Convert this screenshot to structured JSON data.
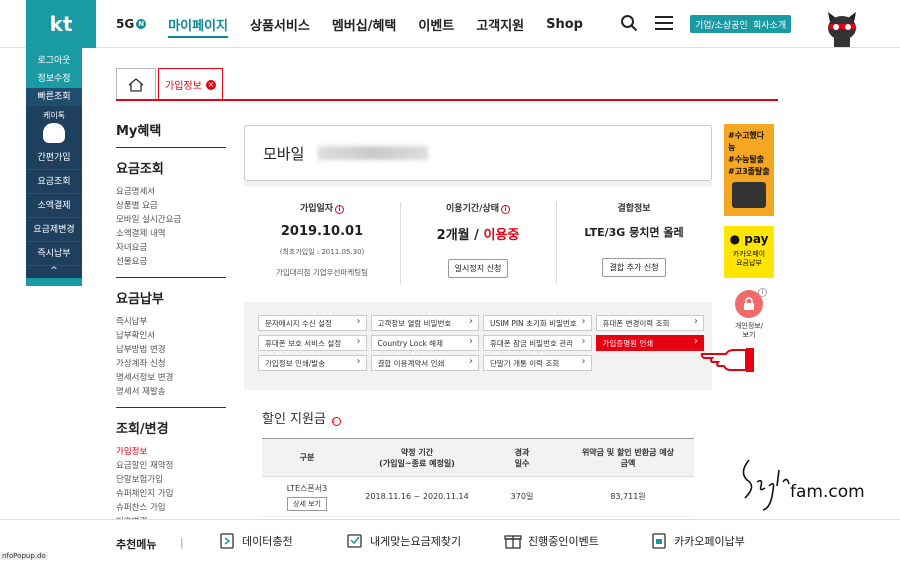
{
  "header": {
    "logo": "kt",
    "nav": [
      {
        "label": "5G",
        "badge": "N"
      },
      {
        "label": "마이페이지"
      },
      {
        "label": "상품서비스"
      },
      {
        "label": "멤버십/혜택"
      },
      {
        "label": "이벤트"
      },
      {
        "label": "고객지원"
      },
      {
        "label": "Shop"
      }
    ],
    "btn_business": "기업/소상공인",
    "btn_company": "회사소개"
  },
  "quick_menu": {
    "items_top": [
      "로그아웃",
      "정보수정",
      "빠른조회"
    ],
    "character_label": "케이톡",
    "items": [
      "간편가입",
      "요금조회",
      "소액결제",
      "요금제변경",
      "즉시납부"
    ],
    "arrow": "^"
  },
  "tabs": {
    "active_label": "가입정보",
    "close": "×"
  },
  "sidemenu": {
    "h_benefit": "My혜택",
    "h_bill": "요금조회",
    "bill_links": [
      "요금명세서",
      "상품별 요금",
      "모바일 실시간요금",
      "소액결제 내역",
      "자녀요금",
      "선물요금"
    ],
    "h_pay": "요금납부",
    "pay_links": [
      "즉시납부",
      "납부확인서",
      "납부방법 변경",
      "가상계좌 신청",
      "명세서정보 변경",
      "명세서 재발송"
    ],
    "h_change": "조회/변경",
    "change_links": [
      "가입정보",
      "요금할인 재약정",
      "단말보험가입",
      "슈퍼체인지 가입",
      "슈퍼찬스 가입",
      "번호변경"
    ]
  },
  "main": {
    "mobile_label": "모바일",
    "join_date_h": "가입일자",
    "join_date": "2019.10.01",
    "first_join": "(최초가입일 : 2011.05.30)",
    "agency": "가입대리점 기업우선마케팅팀",
    "period_h": "이용기간/상태",
    "period": "2개월 /",
    "status": "이용중",
    "suspend_btn": "일시정지 신청",
    "bundle_h": "결합정보",
    "bundle": "LTE/3G 뭉치면 올레",
    "bundle_btn": "결합 추가 신청",
    "actions": [
      "문자메시지 수신 설정",
      "고객정보 열람 비밀번호",
      "USIM PIN 초기화 비밀번호",
      "휴대폰 변경이력 조회",
      "휴대폰 보호 서비스 설정",
      "Country Lock 해제",
      "휴대폰 잠금 비밀번호 관리",
      "가입증명원 인쇄",
      "가입정보 인쇄/발송",
      "결합 이용계약서 인쇄",
      "단말기 개통 이력 조회"
    ],
    "discount_title": "할인 지원금",
    "table_headers": [
      "구분",
      "약정 기간\n(가입일~종료 예정일)",
      "경과\n일수",
      "위약금 및 할인 반환금 예상\n금액"
    ],
    "row": {
      "name": "LTE스폰서3",
      "detail": "상세 보기",
      "period": "2018.11.16 ~ 2020.11.14",
      "days": "370일",
      "amount": "83,711원"
    }
  },
  "right_banners": {
    "ban1": [
      "#수고했다능",
      "#수능탈출",
      "#고3졸탈출"
    ],
    "pay_logo": "pay",
    "pay_text": "카카오페이\n요금납부",
    "lock_text": "개인정보/\n보기"
  },
  "watermark": "fam.com",
  "bottom": {
    "title": "추천메뉴",
    "sep": "|",
    "items": [
      "데이터충전",
      "내게맞는요금제찾기",
      "진행중인이벤트",
      "카카오페이납부"
    ]
  },
  "status_url": "nfoPopup.do",
  "colors": {
    "teal": "#1a9aa2",
    "red": "#e60012",
    "navy": "#1f3f5e"
  }
}
